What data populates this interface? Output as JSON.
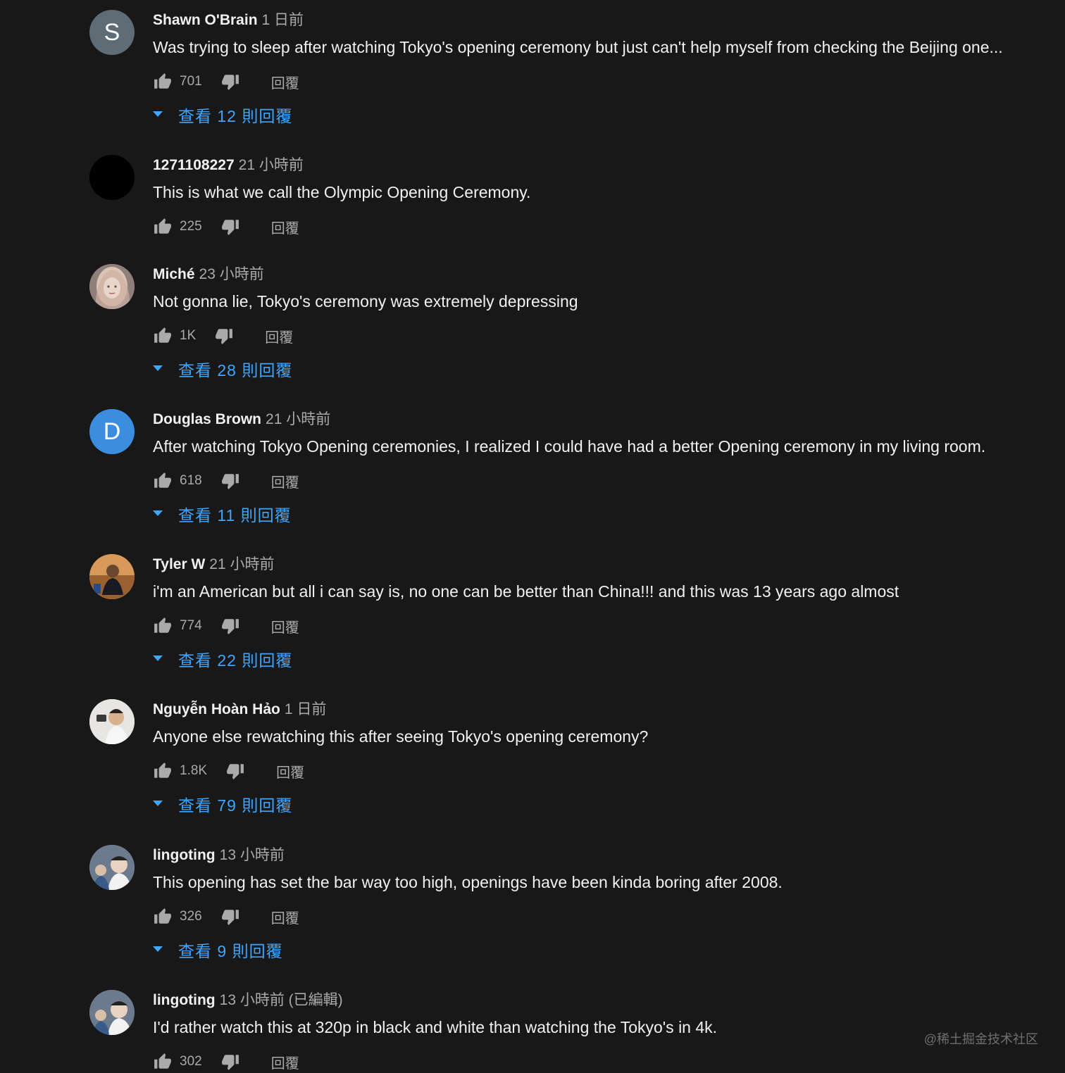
{
  "comments": [
    {
      "author": "Shawn O'Brain",
      "time": "1 日前",
      "text": "Was trying to sleep after watching Tokyo's opening ceremony but just can't help myself from checking the Beijing one...",
      "likes": "701",
      "reply": "回覆",
      "view_replies": "查看 12 則回覆",
      "avatar_letter": "S",
      "avatar_color": "#5f6b75"
    },
    {
      "author": "1271108227",
      "time": "21 小時前",
      "text": "This is what we call the Olympic Opening Ceremony.",
      "likes": "225",
      "reply": "回覆",
      "view_replies": "",
      "avatar_letter": "",
      "avatar_color": "#000000"
    },
    {
      "author": "Miché",
      "time": "23 小時前",
      "text": "Not gonna lie, Tokyo's ceremony was extremely depressing",
      "likes": "1K",
      "reply": "回覆",
      "view_replies": "查看 28 則回覆",
      "avatar_letter": "",
      "avatar_color": "#b89a8f"
    },
    {
      "author": "Douglas Brown",
      "time": "21 小時前",
      "text": "After watching Tokyo Opening ceremonies, I realized I could have had a better Opening ceremony in my living room.",
      "likes": "618",
      "reply": "回覆",
      "view_replies": "查看 11 則回覆",
      "avatar_letter": "D",
      "avatar_color": "#3b8de0"
    },
    {
      "author": "Tyler W",
      "time": "21 小時前",
      "text": "i'm an American but all i can say is, no one can be better than China!!! and this was 13 years ago almost",
      "likes": "774",
      "reply": "回覆",
      "view_replies": "查看 22 則回覆",
      "avatar_letter": "",
      "avatar_color": "#c27a3a"
    },
    {
      "author": "Nguyễn Hoàn Hảo",
      "time": "1 日前",
      "text": "Anyone else rewatching this after seeing Tokyo's opening ceremony?",
      "likes": "1.8K",
      "reply": "回覆",
      "view_replies": "查看 79 則回覆",
      "avatar_letter": "",
      "avatar_color": "#e6e2dc"
    },
    {
      "author": "lingoting",
      "time": "13 小時前",
      "text": "This opening has set the bar way too high, openings have been kinda boring after 2008.",
      "likes": "326",
      "reply": "回覆",
      "view_replies": "查看 9 則回覆",
      "avatar_letter": "",
      "avatar_color": "#7d8a9a"
    },
    {
      "author": "lingoting",
      "time": "13 小時前 (已編輯)",
      "text": "I'd rather watch this at 320p in black and white than watching the Tokyo's in 4k.",
      "likes": "302",
      "reply": "回覆",
      "view_replies": "",
      "avatar_letter": "",
      "avatar_color": "#7d8a9a"
    }
  ],
  "watermark": "@稀土掘金技术社区",
  "colors": {
    "background": "#181818",
    "link": "#3ea6ff",
    "secondary_text": "#aaaaaa"
  }
}
